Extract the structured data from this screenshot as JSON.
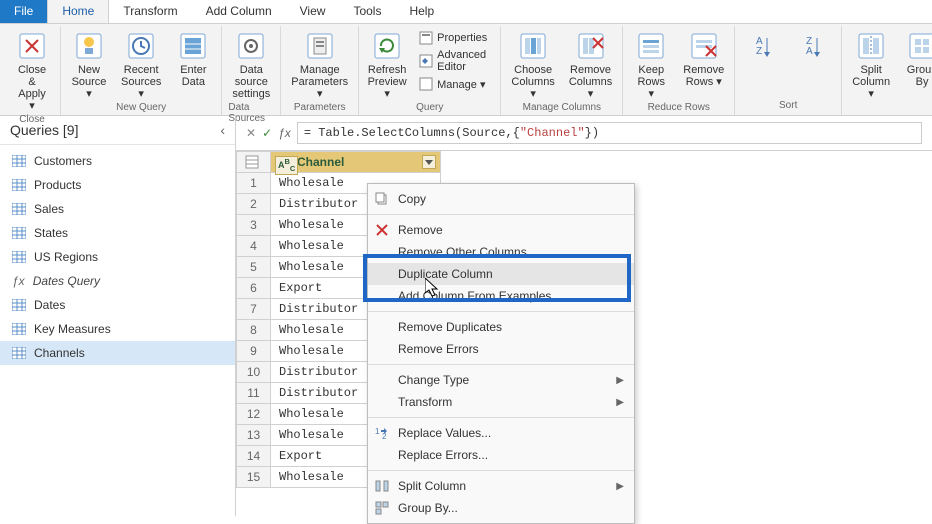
{
  "menu": {
    "file": "File",
    "tabs": [
      "Home",
      "Transform",
      "Add Column",
      "View",
      "Tools",
      "Help"
    ],
    "active": 0
  },
  "ribbon": {
    "groups": [
      {
        "label": "Close",
        "buttons": [
          {
            "label": "Close &\nApply ▾",
            "icon": "close-apply-icon"
          }
        ]
      },
      {
        "label": "New Query",
        "buttons": [
          {
            "label": "New\nSource ▾",
            "icon": "new-source-icon"
          },
          {
            "label": "Recent\nSources ▾",
            "icon": "recent-sources-icon"
          },
          {
            "label": "Enter\nData",
            "icon": "enter-data-icon"
          }
        ]
      },
      {
        "label": "Data Sources",
        "buttons": [
          {
            "label": "Data source\nsettings",
            "icon": "data-source-settings-icon"
          }
        ]
      },
      {
        "label": "Parameters",
        "buttons": [
          {
            "label": "Manage\nParameters ▾",
            "icon": "manage-parameters-icon"
          }
        ]
      },
      {
        "label": "Query",
        "buttons": [
          {
            "label": "Refresh\nPreview ▾",
            "icon": "refresh-preview-icon"
          }
        ],
        "stack": [
          {
            "label": "Properties",
            "icon": "properties-icon"
          },
          {
            "label": "Advanced Editor",
            "icon": "advanced-editor-icon"
          },
          {
            "label": "Manage ▾",
            "icon": "manage-icon"
          }
        ]
      },
      {
        "label": "Manage Columns",
        "buttons": [
          {
            "label": "Choose\nColumns ▾",
            "icon": "choose-columns-icon"
          },
          {
            "label": "Remove\nColumns ▾",
            "icon": "remove-columns-icon"
          }
        ]
      },
      {
        "label": "Reduce Rows",
        "buttons": [
          {
            "label": "Keep\nRows ▾",
            "icon": "keep-rows-icon"
          },
          {
            "label": "Remove\nRows ▾",
            "icon": "remove-rows-icon"
          }
        ]
      },
      {
        "label": "Sort",
        "buttons": [
          {
            "label": "",
            "icon": "sort-asc-icon"
          },
          {
            "label": "",
            "icon": "sort-desc-icon"
          }
        ]
      },
      {
        "label": "",
        "buttons": [
          {
            "label": "Split\nColumn ▾",
            "icon": "split-column-icon"
          },
          {
            "label": "Group\nBy",
            "icon": "group-by-icon"
          }
        ]
      }
    ]
  },
  "queries": {
    "title": "Queries [9]",
    "items": [
      {
        "name": "Customers",
        "type": "table"
      },
      {
        "name": "Products",
        "type": "table"
      },
      {
        "name": "Sales",
        "type": "table"
      },
      {
        "name": "States",
        "type": "table"
      },
      {
        "name": "US Regions",
        "type": "table"
      },
      {
        "name": "Dates Query",
        "type": "fx"
      },
      {
        "name": "Dates",
        "type": "table"
      },
      {
        "name": "Key Measures",
        "type": "table"
      },
      {
        "name": "Channels",
        "type": "table",
        "selected": true
      }
    ]
  },
  "formula": {
    "prefix": "= Table.SelectColumns(Source,{",
    "string": "\"Channel\"",
    "suffix": "})"
  },
  "table": {
    "column": "Channel",
    "rows": [
      "Wholesale",
      "Distributor",
      "Wholesale",
      "Wholesale",
      "Wholesale",
      "Export",
      "Distributor",
      "Wholesale",
      "Wholesale",
      "Distributor",
      "Distributor",
      "Wholesale",
      "Wholesale",
      "Export",
      "Wholesale"
    ]
  },
  "context_menu": {
    "items": [
      {
        "label": "Copy",
        "icon": "copy-icon"
      },
      {
        "hr": true
      },
      {
        "label": "Remove",
        "icon": "remove-icon"
      },
      {
        "label": "Remove Other Columns"
      },
      {
        "label": "Duplicate Column",
        "hover": true
      },
      {
        "label": "Add Column From Examples..."
      },
      {
        "hr": true
      },
      {
        "label": "Remove Duplicates"
      },
      {
        "label": "Remove Errors"
      },
      {
        "hr": true
      },
      {
        "label": "Change Type",
        "sub": true
      },
      {
        "label": "Transform",
        "sub": true
      },
      {
        "hr": true
      },
      {
        "label": "Replace Values...",
        "icon": "replace-values-icon"
      },
      {
        "label": "Replace Errors..."
      },
      {
        "hr": true
      },
      {
        "label": "Split Column",
        "icon": "split-column-small-icon",
        "sub": true
      },
      {
        "label": "Group By...",
        "icon": "group-by-small-icon"
      }
    ]
  }
}
